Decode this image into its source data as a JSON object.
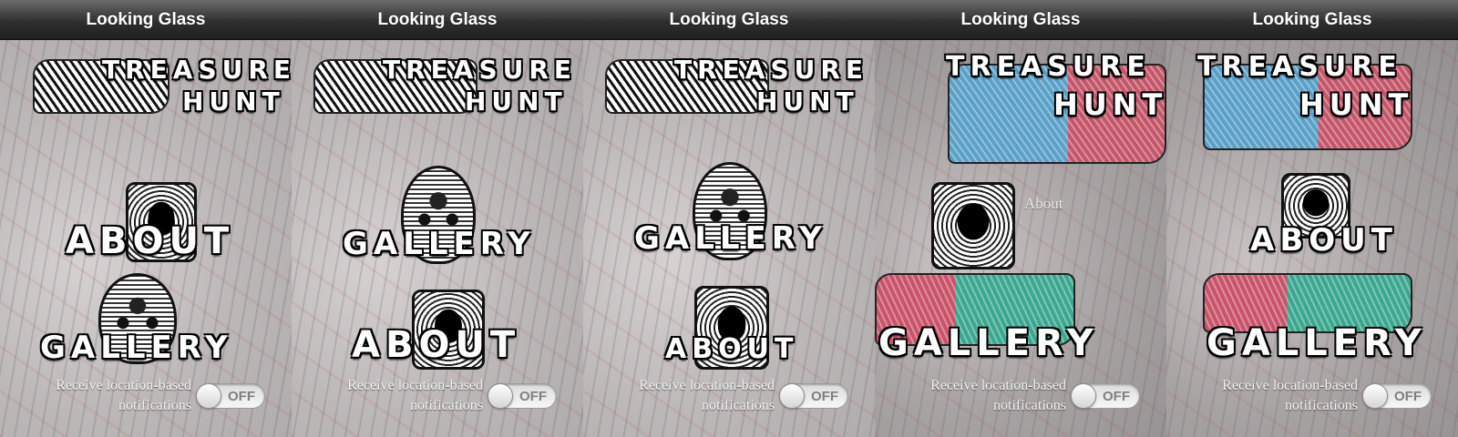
{
  "app_title": "Looking Glass",
  "screens": [
    {
      "nav_title": "Looking Glass",
      "menu": [
        "TREASURE",
        "HUNT",
        "ABOUT",
        "GALLERY"
      ],
      "notifications_label": "Receive location-based notifications",
      "toggle_state": "OFF"
    },
    {
      "nav_title": "Looking Glass",
      "menu": [
        "TREASURE",
        "HUNT",
        "GALLERY",
        "ABOUT"
      ],
      "notifications_label": "Receive location-based notifications",
      "toggle_state": "OFF"
    },
    {
      "nav_title": "Looking Glass",
      "menu": [
        "TREASURE",
        "HUNT",
        "GALLERY",
        "ABOUT"
      ],
      "notifications_label": "Receive location-based notifications",
      "toggle_state": "OFF"
    },
    {
      "nav_title": "Looking Glass",
      "menu": [
        "TREASURE",
        "HUNT",
        "GALLERY"
      ],
      "about_link": "About",
      "notifications_label": "Receive location-based notifications",
      "toggle_state": "OFF"
    },
    {
      "nav_title": "Looking Glass",
      "menu": [
        "TREASURE",
        "HUNT",
        "ABOUT",
        "GALLERY"
      ],
      "notifications_label": "Receive location-based notifications",
      "toggle_state": "OFF"
    }
  ],
  "colors": {
    "navbar": "#2f2f2f",
    "title_text": "#ffffff",
    "toggle_off_text": "#7f7f7f"
  },
  "icons": [
    "hand-artwork",
    "face-artwork",
    "tile-artwork",
    "toggle-switch"
  ]
}
